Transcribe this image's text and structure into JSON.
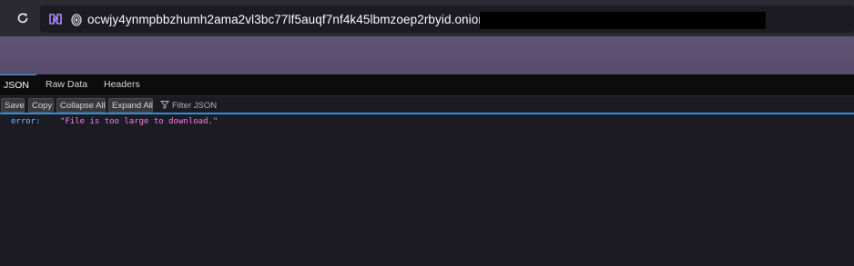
{
  "browser": {
    "url": "ocwjy4ynmpbbzhumh2ama2vl3bc77lf5auqf7nf4k45lbmzoep2rbyid.onion",
    "icons": {
      "back": "back-arrow-icon",
      "reload": "reload-icon",
      "tor": "tor-browser-icon",
      "onion": "onion-site-icon"
    }
  },
  "viewer": {
    "tabs": [
      {
        "label": "JSON",
        "active": true
      },
      {
        "label": "Raw Data",
        "active": false
      },
      {
        "label": "Headers",
        "active": false
      }
    ],
    "actions": {
      "save": "Save",
      "copy": "Copy",
      "collapse_all": "Collapse All",
      "expand_all": "Expand All",
      "filter_placeholder": "Filter JSON"
    }
  },
  "json": {
    "rows": [
      {
        "key": "error:",
        "value": "\"File is too large to download.\""
      }
    ]
  },
  "colors": {
    "accent": "#2f8fde",
    "banner": "#5a4f70",
    "json_key": "#75bfff",
    "json_string": "#ff7de9"
  }
}
